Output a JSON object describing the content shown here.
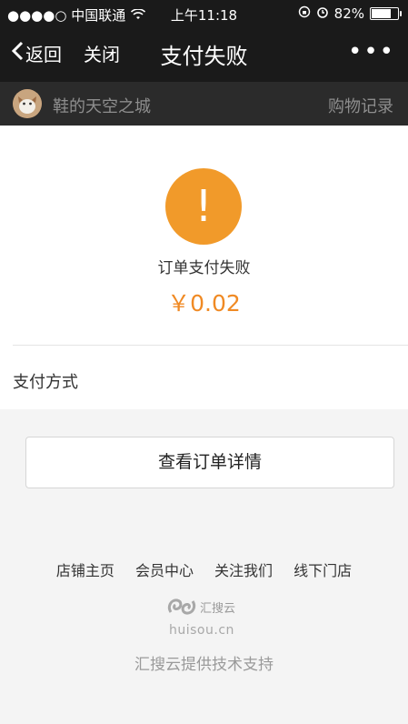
{
  "status_bar": {
    "carrier": "●●●●○ 中国联通",
    "time": "上午11:18",
    "battery": "82%",
    "battery_level": 0.82
  },
  "nav": {
    "back_label": "返回",
    "close_label": "关闭",
    "title": "支付失败",
    "more": "•••"
  },
  "shop": {
    "name": "鞋的天空之城",
    "records_label": "购物记录"
  },
  "result": {
    "icon": "!",
    "message": "订单支付失败",
    "amount": "￥0.02"
  },
  "payment": {
    "method_label": "支付方式"
  },
  "actions": {
    "view_order": "查看订单详情"
  },
  "footer": {
    "links": [
      "店铺主页",
      "会员中心",
      "关注我们",
      "线下门店"
    ],
    "logo_brand": "汇搜云",
    "logo_domain": "huisou.cn",
    "tech_support": "汇搜云提供技术支持"
  },
  "colors": {
    "accent": "#f19a2a",
    "amount": "#f08a24",
    "nav_bg": "#1a1a1a"
  }
}
